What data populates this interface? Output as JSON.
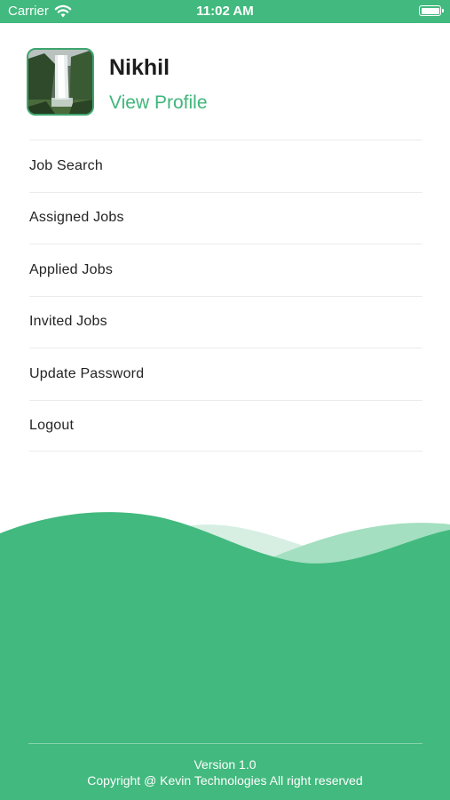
{
  "status_bar": {
    "carrier": "Carrier",
    "time": "11:02 AM",
    "wifi_icon": "wifi-icon",
    "battery_icon": "battery-icon"
  },
  "profile": {
    "name": "Nikhil",
    "view_profile": "View Profile",
    "avatar_icon": "waterfall-photo"
  },
  "menu": {
    "items": [
      {
        "label": "Job Search"
      },
      {
        "label": "Assigned Jobs"
      },
      {
        "label": "Applied Jobs"
      },
      {
        "label": "Invited Jobs"
      },
      {
        "label": "Update Password"
      },
      {
        "label": "Logout"
      }
    ]
  },
  "footer": {
    "version": "Version 1.0",
    "copyright": "Copyright @ Kevin Technologies All right reserved"
  },
  "colors": {
    "accent": "#42b97e",
    "wave_light": "#a3dfc0",
    "wave_lighter": "#d6efe2"
  }
}
